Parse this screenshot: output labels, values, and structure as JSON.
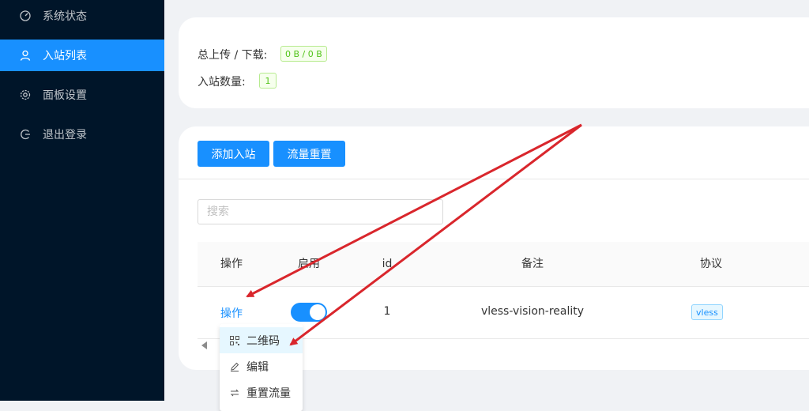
{
  "sidebar": {
    "items": [
      {
        "label": "系统状态",
        "icon": "dashboard-icon"
      },
      {
        "label": "入站列表",
        "icon": "user-icon",
        "active": true
      },
      {
        "label": "面板设置",
        "icon": "gear-icon"
      },
      {
        "label": "退出登录",
        "icon": "logout-icon"
      }
    ]
  },
  "stats": {
    "traffic_label": "总上传 / 下载:",
    "traffic_value": "0 B / 0 B",
    "count_label": "入站数量:",
    "count_value": "1"
  },
  "toolbar": {
    "add_label": "添加入站",
    "reset_label": "流量重置"
  },
  "search": {
    "placeholder": "搜索"
  },
  "table": {
    "columns": [
      "操作",
      "启用",
      "id",
      "备注",
      "协议"
    ],
    "rows": [
      {
        "action": "操作",
        "enabled": true,
        "id": "1",
        "remark": "vless-vision-reality",
        "protocol": "vless"
      }
    ]
  },
  "dropdown": {
    "items": [
      {
        "label": "二维码",
        "icon": "qrcode-icon"
      },
      {
        "label": "编辑",
        "icon": "edit-icon"
      },
      {
        "label": "重置流量",
        "icon": "swap-icon"
      }
    ]
  },
  "colors": {
    "sidebar_bg": "#001529",
    "accent": "#1890ff",
    "annotation_arrow": "#d9262c"
  }
}
